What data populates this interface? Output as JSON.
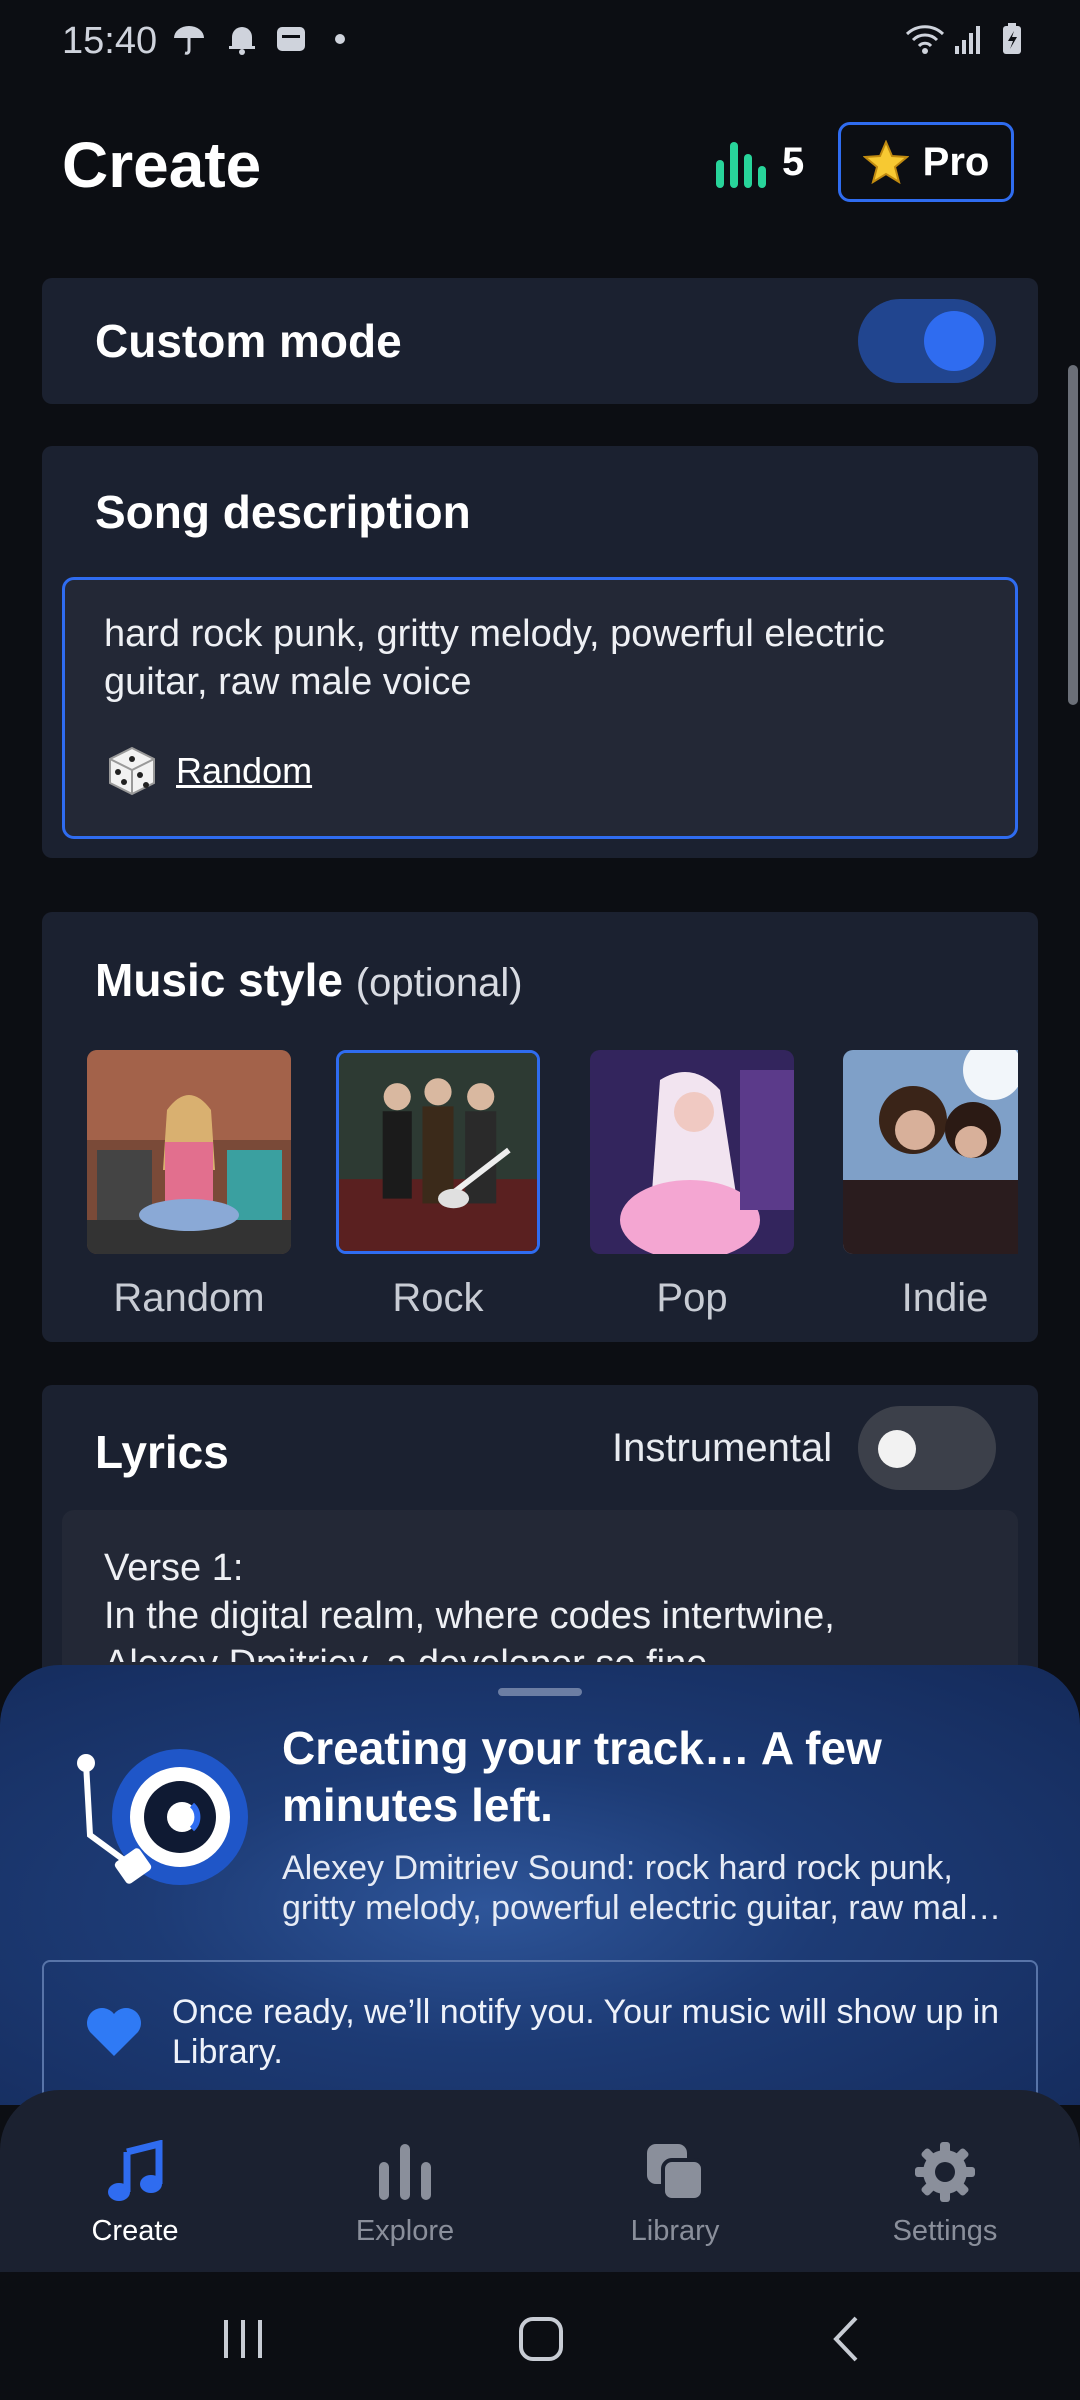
{
  "status_bar": {
    "time": "15:40"
  },
  "header": {
    "title": "Create",
    "credits": "5",
    "pro_label": "Pro"
  },
  "custom_mode": {
    "label": "Custom mode",
    "enabled": true
  },
  "song_description": {
    "title": "Song description",
    "value": "hard rock punk, gritty melody, powerful electric guitar, raw male voice",
    "random_label": "Random"
  },
  "music_style": {
    "title": "Music style",
    "optional": "(optional)",
    "items": [
      {
        "label": "Random",
        "selected": false
      },
      {
        "label": "Rock",
        "selected": true
      },
      {
        "label": "Pop",
        "selected": false
      },
      {
        "label": "Indie",
        "selected": false
      }
    ]
  },
  "lyrics": {
    "title": "Lyrics",
    "instrumental_label": "Instrumental",
    "instrumental": false,
    "line1": "Verse 1:",
    "line2": "In the digital realm, where codes intertwine,",
    "line3": "Alexey Dmitriev, a developer so fine"
  },
  "progress_sheet": {
    "title": "Creating your track… A few minutes left.",
    "subtitle": "Alexey Dmitriev Sound: rock hard rock punk, gritty melody, powerful electric guitar, raw mal…",
    "notice": "Once ready, we’ll notify you. Your music will show up in Library."
  },
  "nav": {
    "create": "Create",
    "explore": "Explore",
    "library": "Library",
    "settings": "Settings"
  },
  "colors": {
    "accent": "#2f6cf0",
    "credits": "#28d49a",
    "card": "#1b2130",
    "background": "#0c0e13"
  }
}
